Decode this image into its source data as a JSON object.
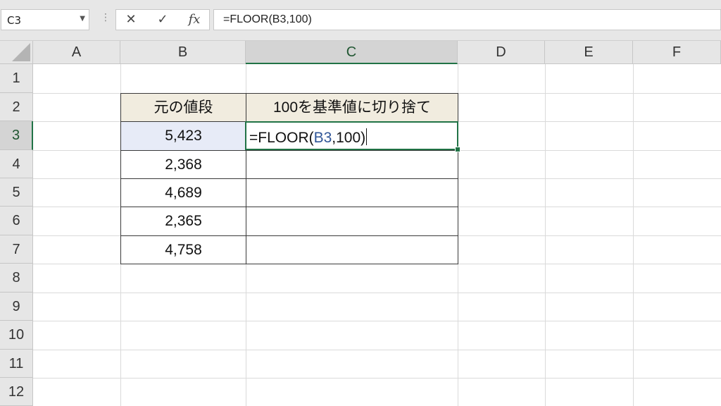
{
  "name_box": {
    "value": "C3"
  },
  "formula_bar": {
    "cancel_glyph": "✕",
    "enter_glyph": "✓",
    "fx_label": "fx",
    "formula": "=FLOOR(B3,100)"
  },
  "columns": [
    "A",
    "B",
    "C",
    "D",
    "E",
    "F"
  ],
  "rows": [
    "1",
    "2",
    "3",
    "4",
    "5",
    "6",
    "7",
    "8",
    "9",
    "10",
    "11",
    "12"
  ],
  "active_cell": {
    "column": "C",
    "row": "3"
  },
  "table": {
    "headers": [
      "元の値段",
      "100を基準値に切り捨て"
    ],
    "values": [
      "5,423",
      "2,368",
      "4,689",
      "2,365",
      "4,758"
    ]
  },
  "edit": {
    "prefix": "=FLOOR(",
    "reference": "B3",
    "suffix": ",100)"
  },
  "colors": {
    "accent": "#217346",
    "header_fill": "#f1ecdf",
    "reference": "#2f5597",
    "selection_fill": "#e7ebf7"
  }
}
